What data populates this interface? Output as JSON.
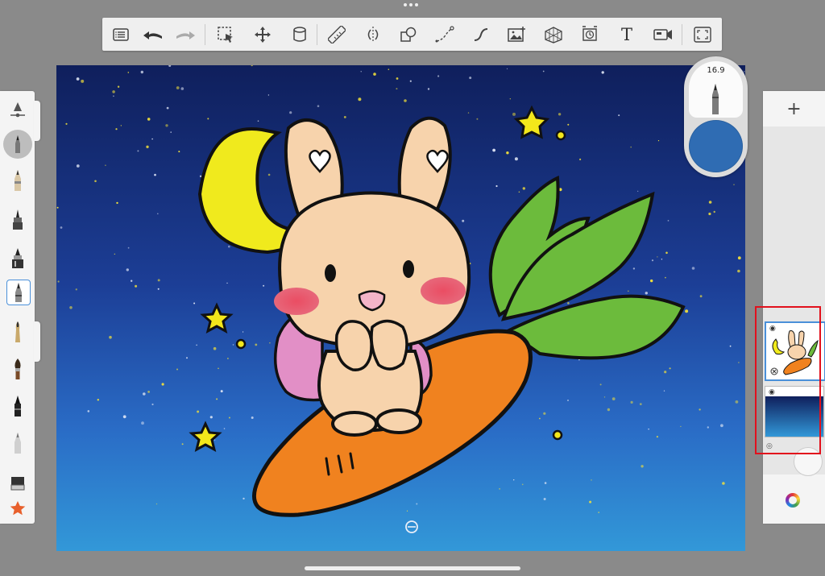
{
  "app": {
    "toolbar": {
      "text_tool_label": "T",
      "tools": [
        "menu-icon",
        "undo-icon",
        "redo-icon",
        "selection-icon",
        "transform-icon",
        "fill-icon",
        "ruler-icon",
        "symmetry-icon",
        "shapes-icon",
        "lines-icon",
        "curve-icon",
        "add-image-icon",
        "perspective-icon",
        "time-lapse-icon",
        "text-icon",
        "record-icon",
        "fullscreen-icon"
      ]
    },
    "brush_puck": {
      "size_value": "16.9",
      "color": "#2f6cb3"
    },
    "layers": {
      "add_label": "+",
      "items": [
        "layer-bunny",
        "layer-background"
      ]
    },
    "colors": {
      "highlight": "#e2101c",
      "selected": "#4a90d9"
    }
  }
}
